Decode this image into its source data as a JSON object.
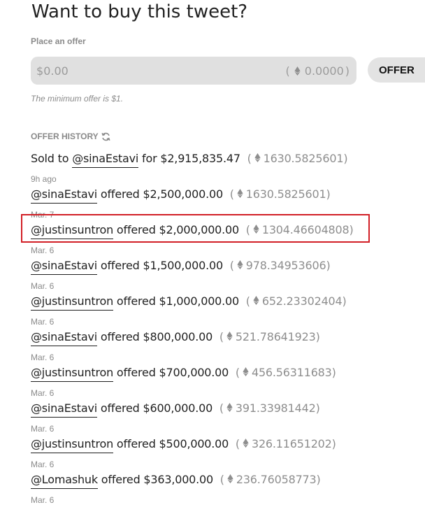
{
  "header": {
    "title": "Want to buy this tweet?"
  },
  "offer": {
    "label": "Place an offer",
    "currency_symbol": "$",
    "amount_placeholder": "0.00",
    "eth_value": "0.0000",
    "button_label": "OFFER",
    "minimum_note": "The minimum offer is $1."
  },
  "history": {
    "label": "OFFER HISTORY",
    "sold": {
      "prefix": "Sold to",
      "user": "@sinaEstavi",
      "verb": "for",
      "amount": "$2,915,835.47",
      "eth": "1630.5825601",
      "date": "9h ago"
    },
    "offers": [
      {
        "user": "@sinaEstavi",
        "verb": "offered",
        "amount": "$2,500,000.00",
        "eth": "1630.5825601",
        "date": "Mar. 7"
      },
      {
        "user": "@justinsuntron",
        "verb": "offered",
        "amount": "$2,000,000.00",
        "eth": "1304.46604808",
        "date": "Mar. 6"
      },
      {
        "user": "@sinaEstavi",
        "verb": "offered",
        "amount": "$1,500,000.00",
        "eth": "978.34953606",
        "date": "Mar. 6"
      },
      {
        "user": "@justinsuntron",
        "verb": "offered",
        "amount": "$1,000,000.00",
        "eth": "652.23302404",
        "date": "Mar. 6"
      },
      {
        "user": "@sinaEstavi",
        "verb": "offered",
        "amount": "$800,000.00",
        "eth": "521.78641923",
        "date": "Mar. 6"
      },
      {
        "user": "@justinsuntron",
        "verb": "offered",
        "amount": "$700,000.00",
        "eth": "456.56311683",
        "date": "Mar. 6"
      },
      {
        "user": "@sinaEstavi",
        "verb": "offered",
        "amount": "$600,000.00",
        "eth": "391.33981442",
        "date": "Mar. 6"
      },
      {
        "user": "@justinsuntron",
        "verb": "offered",
        "amount": "$500,000.00",
        "eth": "326.11651202",
        "date": "Mar. 6"
      },
      {
        "user": "@Lomashuk",
        "verb": "offered",
        "amount": "$363,000.00",
        "eth": "236.76058773",
        "date": "Mar. 6"
      }
    ]
  },
  "icons": {
    "eth": "ethereum-icon",
    "refresh": "refresh-icon"
  },
  "colors": {
    "highlight": "#d21f26",
    "muted": "#8a8a8a",
    "input_bg": "#e0e0e0"
  }
}
